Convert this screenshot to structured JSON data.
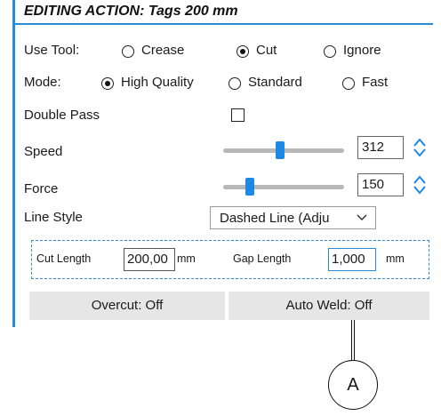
{
  "header": {
    "title": "EDITING ACTION: Tags 200 mm"
  },
  "use_tool": {
    "label": "Use Tool:",
    "options": [
      "Crease",
      "Cut",
      "Ignore"
    ],
    "selected": "Cut"
  },
  "mode": {
    "label": "Mode:",
    "options": [
      "High Quality",
      "Standard",
      "Fast"
    ],
    "selected": "High Quality"
  },
  "double_pass": {
    "label": "Double Pass",
    "checked": false
  },
  "speed": {
    "label": "Speed",
    "value": "312",
    "level_fraction": 0.47
  },
  "force": {
    "label": "Force",
    "value": "150",
    "level_fraction": 0.22
  },
  "line_style": {
    "label": "Line Style",
    "selected": "Dashed Line (Adju"
  },
  "dashed_settings": {
    "cut_length_label": "Cut Length",
    "cut_length_value": "200,00",
    "cut_length_unit": "mm",
    "gap_length_label": "Gap Length",
    "gap_length_value": "1,000",
    "gap_length_unit": "mm"
  },
  "buttons": {
    "overcut": "Overcut: Off",
    "auto_weld": "Auto Weld: Off"
  },
  "callout": {
    "label": "A"
  },
  "colors": {
    "accent": "#2a8bd8",
    "slider_thumb": "#1e88e5",
    "button_bg": "#e6e6e6"
  }
}
